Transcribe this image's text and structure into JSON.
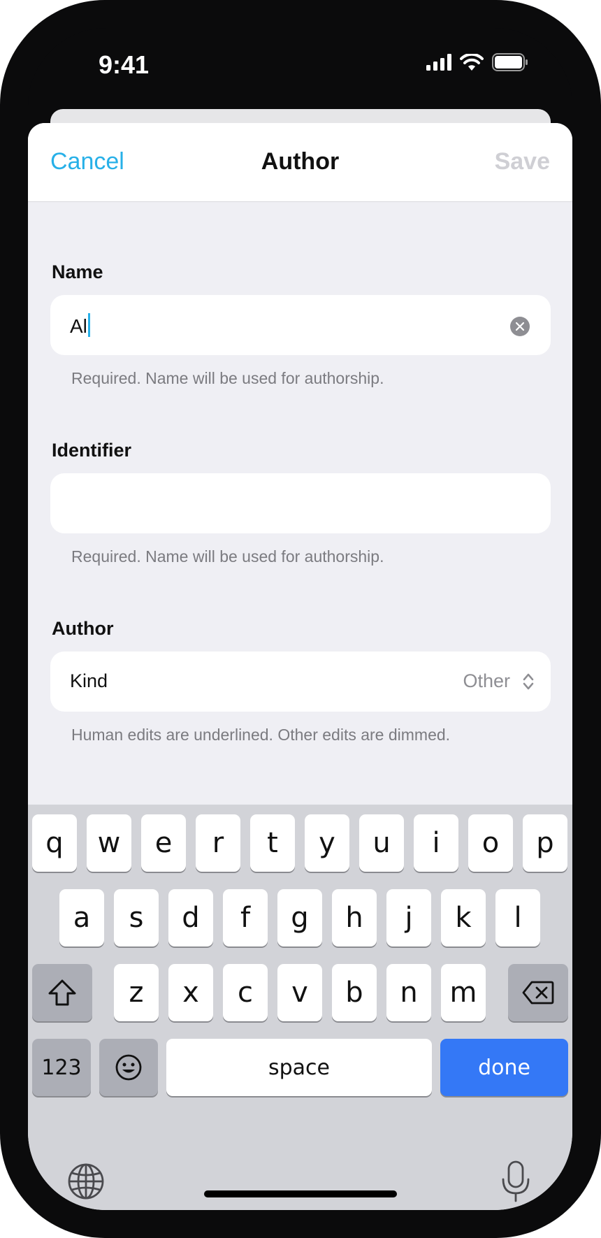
{
  "status_bar": {
    "time": "9:41"
  },
  "nav": {
    "cancel": "Cancel",
    "title": "Author",
    "save": "Save"
  },
  "name_section": {
    "title": "Name",
    "value": "Al",
    "helper": "Required. Name will be used for authorship."
  },
  "identifier_section": {
    "title": "Identifier",
    "value": "",
    "helper": "Required. Name will be used for authorship."
  },
  "author_section": {
    "title": "Author",
    "kind_label": "Kind",
    "kind_value": "Other",
    "helper": "Human edits are underlined. Other edits are dimmed."
  },
  "keyboard": {
    "row1": [
      "q",
      "w",
      "e",
      "r",
      "t",
      "y",
      "u",
      "i",
      "o",
      "p"
    ],
    "row2": [
      "a",
      "s",
      "d",
      "f",
      "g",
      "h",
      "j",
      "k",
      "l"
    ],
    "row3": [
      "z",
      "x",
      "c",
      "v",
      "b",
      "n",
      "m"
    ],
    "numbers": "123",
    "space": "space",
    "done": "done"
  },
  "colors": {
    "accent": "#27b0e8",
    "done_key": "#3478f6",
    "sheet_bg": "#efeff4",
    "keyboard_bg": "#d2d3d8"
  },
  "icons": [
    "signal-icon",
    "wifi-icon",
    "battery-icon",
    "clear-icon",
    "chevron-updown-icon",
    "shift-icon",
    "delete-icon",
    "emoji-icon",
    "globe-icon",
    "microphone-icon"
  ]
}
